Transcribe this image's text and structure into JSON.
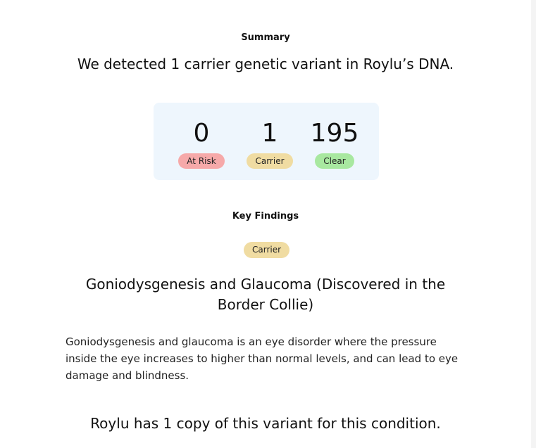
{
  "summary": {
    "heading": "Summary",
    "headline": "We detected 1 carrier genetic variant in Roylu’s DNA."
  },
  "stats": {
    "at_risk": {
      "value": "0",
      "label": "At Risk"
    },
    "carrier": {
      "value": "1",
      "label": "Carrier"
    },
    "clear": {
      "value": "195",
      "label": "Clear"
    }
  },
  "key_findings": {
    "heading": "Key Findings",
    "status_badge": "Carrier",
    "condition_title": "Goniodysgenesis and Glaucoma (Discovered in the Border Collie)",
    "description": "Goniodysgenesis and glaucoma is an eye disorder where the pressure inside the eye increases to higher than normal levels, and can lead to eye damage and blindness.",
    "copy_statement": "Roylu has 1 copy of this variant for this condition."
  },
  "colors": {
    "at_risk_pill": "#f6a9a9",
    "carrier_pill": "#f0dca2",
    "clear_pill": "#a8e8a0",
    "stats_card_bg": "#eef6fd"
  }
}
